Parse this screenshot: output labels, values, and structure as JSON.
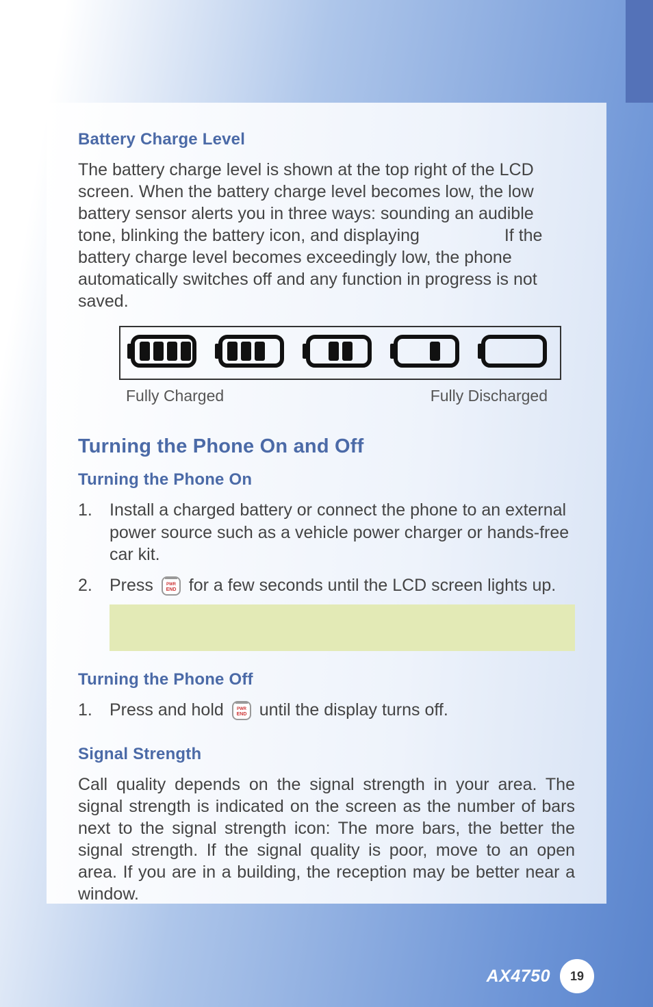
{
  "sections": {
    "battery_level": {
      "heading": "Battery Charge Level",
      "para_a": "The battery charge level is shown at the top right of the LCD screen. When the battery charge level becomes low, the low battery sensor alerts you in three ways: sounding an audible tone, blinking the battery icon, and displaying",
      "para_b": "If the battery charge level becomes exceedingly low, the phone automatically switches off and any function in progress is not saved.",
      "label_left": "Fully Charged",
      "label_right": "Fully Discharged"
    },
    "turning": {
      "heading": "Turning the Phone On and Off",
      "on_heading": "Turning the Phone On",
      "on_steps": [
        "Install a charged battery or connect the phone to an external power source such as a vehicle power charger or hands-free car kit.",
        "Press  for a few seconds until the LCD screen lights up."
      ],
      "off_heading": "Turning the Phone Off",
      "off_step_a": "Press and hold",
      "off_step_b": "until the display turns off."
    },
    "signal": {
      "heading": "Signal Strength",
      "para": "Call quality depends on the signal strength in your area. The signal strength is indicated on the screen as the number of bars next to the signal strength icon: The more bars, the better the signal strength. If the signal quality is poor, move to an open area. If you are in a building, the reception may be better near a window."
    }
  },
  "footer": {
    "model": "AX4750",
    "page": "19"
  },
  "icons": {
    "end_key": "end-key-icon",
    "battery": "battery-icon"
  }
}
